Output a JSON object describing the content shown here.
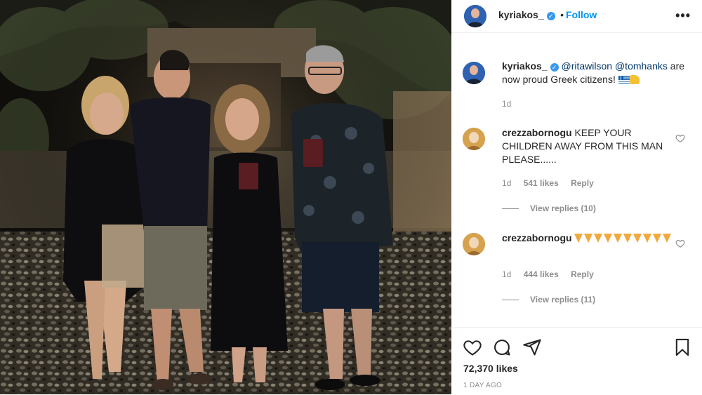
{
  "post": {
    "author": "kyriakos_",
    "follow_label": "Follow",
    "dot": "•",
    "more_label": "•••"
  },
  "caption": {
    "author": "kyriakos_",
    "mention_1": "@ritawilson",
    "mention_2": "@tomhanks",
    "text": "are now proud Greek citizens!",
    "age": "1d"
  },
  "comments": [
    {
      "author": "crezzabornogu",
      "text": "KEEP YOUR CHILDREN AWAY FROM THIS MAN PLEASE......",
      "age": "1d",
      "likes": "541 likes",
      "reply_label": "Reply",
      "view_replies": "View replies (10)"
    },
    {
      "author": "crezzabornogu",
      "text": "",
      "pizza_count": 10,
      "age": "1d",
      "likes": "444 likes",
      "reply_label": "Reply",
      "view_replies": "View replies (11)"
    }
  ],
  "footer": {
    "likes": "72,370 likes",
    "date": "1 DAY AGO"
  },
  "icons": {
    "like": "heart-icon",
    "comment": "comment-icon",
    "share": "share-icon",
    "save": "bookmark-icon"
  },
  "colors": {
    "link_blue": "#0095f6",
    "verified_blue": "#3897f0",
    "muted": "#8e8e8e",
    "text": "#262626"
  }
}
